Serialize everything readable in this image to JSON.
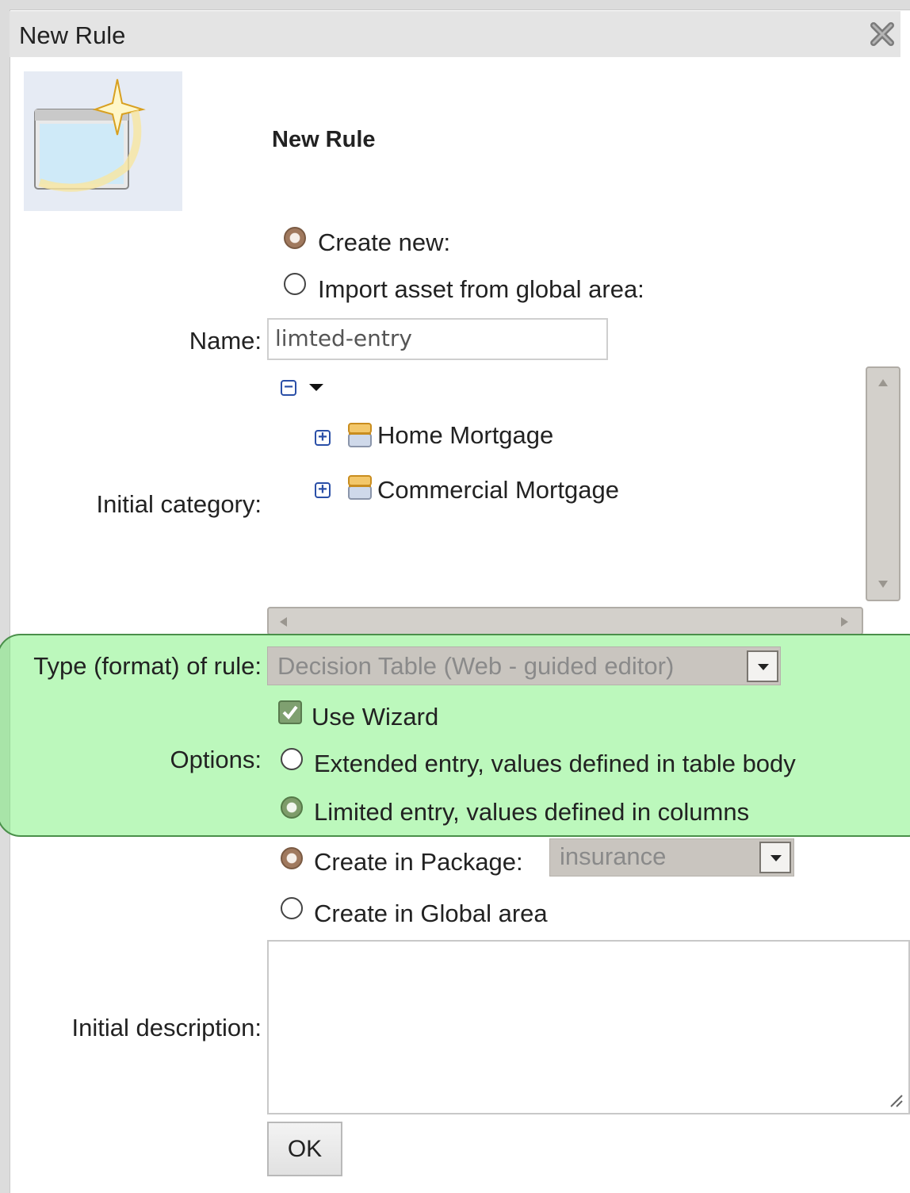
{
  "dialog": {
    "title": "New Rule",
    "heading": "New Rule"
  },
  "source": {
    "create_new_label": "Create new:",
    "import_label": "Import asset from global area:",
    "selected": "Create new:"
  },
  "name": {
    "label": "Name:",
    "value": "limted-entry"
  },
  "category": {
    "label": "Initial category:",
    "items": [
      {
        "label": "Home Mortgage"
      },
      {
        "label": "Commercial Mortgage"
      }
    ]
  },
  "rule_type": {
    "label": "Type (format) of rule:",
    "value": "Decision Table (Web - guided editor)"
  },
  "options": {
    "label": "Options:",
    "use_wizard_label": "Use Wizard",
    "use_wizard_checked": true,
    "extended_label": "Extended entry, values defined in table body",
    "limited_label": "Limited entry, values defined in columns",
    "selected": "Limited entry, values defined in columns"
  },
  "location": {
    "package_label": "Create in Package:",
    "package_value": "insurance",
    "global_label": "Create in Global area",
    "selected": "Create in Package:"
  },
  "description": {
    "label": "Initial description:",
    "value": ""
  },
  "actions": {
    "ok_label": "OK"
  },
  "colors": {
    "highlight": "#60ee60",
    "radio_selected": "#a0795e",
    "folder": "#e8b34a"
  }
}
